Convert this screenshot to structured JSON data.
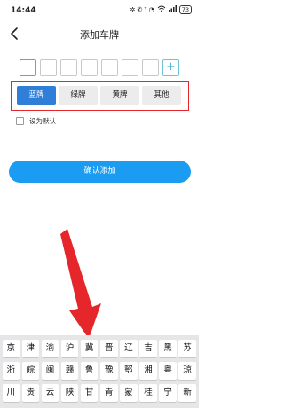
{
  "status_bar": {
    "time": "14:44",
    "icons_text": "✲ ✆ ᵀ ◔ ",
    "battery": "73"
  },
  "header": {
    "title": "添加车牌",
    "back_icon": "chevron-left-icon"
  },
  "plate_input": {
    "add_button_label": "+"
  },
  "plate_type_tabs": [
    {
      "label": "蓝牌",
      "active": true
    },
    {
      "label": "绿牌",
      "active": false
    },
    {
      "label": "黄牌",
      "active": false
    },
    {
      "label": "其他",
      "active": false
    }
  ],
  "default_option": {
    "label": "设为默认",
    "checked": false
  },
  "confirm_button": {
    "label": "确认添加"
  },
  "keyboard": {
    "rows": [
      [
        "京",
        "津",
        "渝",
        "沪",
        "冀",
        "晋",
        "辽",
        "吉",
        "黑",
        "苏"
      ],
      [
        "浙",
        "皖",
        "闽",
        "赣",
        "鲁",
        "豫",
        "鄂",
        "湘",
        "粤",
        "琼"
      ],
      [
        "川",
        "贵",
        "云",
        "陕",
        "甘",
        "青",
        "蒙",
        "桂",
        "宁",
        "新"
      ]
    ]
  },
  "colors": {
    "accent": "#1a9cf2",
    "active_tab": "#2f7fd8",
    "highlight_frame": "#e5262a",
    "annotation_arrow": "#e5262a"
  }
}
